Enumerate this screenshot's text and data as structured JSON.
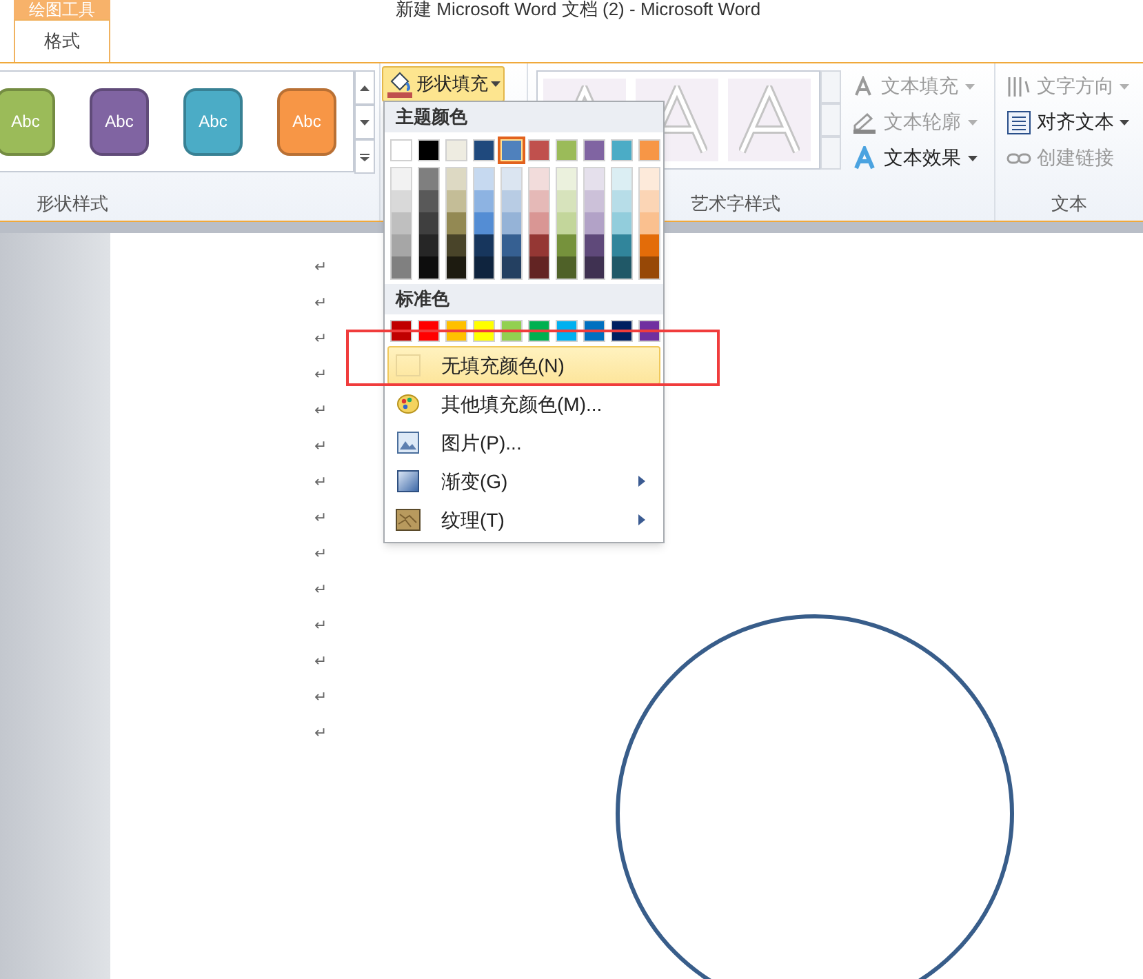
{
  "window": {
    "title": "新建 Microsoft Word 文档 (2) - Microsoft Word"
  },
  "contextual_tab": {
    "label": "绘图工具"
  },
  "tabs": [
    {
      "label": "格式",
      "selected": true
    }
  ],
  "shape_styles": {
    "items": [
      {
        "label": "Abc",
        "color": "#9bbb59"
      },
      {
        "label": "Abc",
        "color": "#8064a2"
      },
      {
        "label": "Abc",
        "color": "#4bacc6"
      },
      {
        "label": "Abc",
        "color": "#f79646"
      }
    ],
    "group_label": "形状样式"
  },
  "shape_fill_button": {
    "label": "形状填充"
  },
  "wordart": {
    "group_label": "艺术字样式",
    "commands": [
      {
        "label": "文本填充",
        "disabled": true
      },
      {
        "label": "文本轮廓",
        "disabled": true
      },
      {
        "label": "文本效果",
        "disabled": false
      }
    ]
  },
  "text_group": {
    "group_label": "文本",
    "commands": [
      {
        "label": "文字方向",
        "disabled": true
      },
      {
        "label": "对齐文本",
        "disabled": false
      },
      {
        "label": "创建链接",
        "disabled": true
      }
    ]
  },
  "fill_menu": {
    "theme_heading": "主题颜色",
    "theme_colors": [
      {
        "color": "#ffffff",
        "selected": false,
        "shades": [
          {
            "color": "#f2f2f2"
          },
          {
            "color": "#d9d9d9"
          },
          {
            "color": "#bfbfbf"
          },
          {
            "color": "#a6a6a6"
          },
          {
            "color": "#808080"
          }
        ]
      },
      {
        "color": "#000000",
        "selected": false,
        "shades": [
          {
            "color": "#7f7f7f"
          },
          {
            "color": "#595959"
          },
          {
            "color": "#3f3f3f"
          },
          {
            "color": "#262626"
          },
          {
            "color": "#0d0d0d"
          }
        ]
      },
      {
        "color": "#eeece1",
        "selected": false,
        "shades": [
          {
            "color": "#ddd9c3"
          },
          {
            "color": "#c4bd97"
          },
          {
            "color": "#938953"
          },
          {
            "color": "#494429"
          },
          {
            "color": "#1d1b10"
          }
        ]
      },
      {
        "color": "#1f497d",
        "selected": false,
        "shades": [
          {
            "color": "#c6d9f0"
          },
          {
            "color": "#8db3e2"
          },
          {
            "color": "#548dd4"
          },
          {
            "color": "#17365d"
          },
          {
            "color": "#0f243e"
          }
        ]
      },
      {
        "color": "#4f81bd",
        "selected": true,
        "shades": [
          {
            "color": "#dbe5f1"
          },
          {
            "color": "#b8cce4"
          },
          {
            "color": "#95b3d7"
          },
          {
            "color": "#366092"
          },
          {
            "color": "#244061"
          }
        ]
      },
      {
        "color": "#c0504d",
        "selected": false,
        "shades": [
          {
            "color": "#f2dcdb"
          },
          {
            "color": "#e5b9b7"
          },
          {
            "color": "#d99694"
          },
          {
            "color": "#953734"
          },
          {
            "color": "#632423"
          }
        ]
      },
      {
        "color": "#9bbb59",
        "selected": false,
        "shades": [
          {
            "color": "#ebf1dd"
          },
          {
            "color": "#d7e3bc"
          },
          {
            "color": "#c3d69b"
          },
          {
            "color": "#76923c"
          },
          {
            "color": "#4f6128"
          }
        ]
      },
      {
        "color": "#8064a2",
        "selected": false,
        "shades": [
          {
            "color": "#e5e0ec"
          },
          {
            "color": "#ccc1d9"
          },
          {
            "color": "#b2a2c7"
          },
          {
            "color": "#5f497a"
          },
          {
            "color": "#3f3151"
          }
        ]
      },
      {
        "color": "#4bacc6",
        "selected": false,
        "shades": [
          {
            "color": "#dbeef3"
          },
          {
            "color": "#b7dde8"
          },
          {
            "color": "#92cddc"
          },
          {
            "color": "#31859b"
          },
          {
            "color": "#205867"
          }
        ]
      },
      {
        "color": "#f79646",
        "selected": false,
        "shades": [
          {
            "color": "#fdeada"
          },
          {
            "color": "#fbd5b5"
          },
          {
            "color": "#fac08f"
          },
          {
            "color": "#e36c09"
          },
          {
            "color": "#974806"
          }
        ]
      }
    ],
    "standard_heading": "标准色",
    "standard_colors": [
      {
        "color": "#c00000"
      },
      {
        "color": "#ff0000"
      },
      {
        "color": "#ffc000"
      },
      {
        "color": "#ffff00"
      },
      {
        "color": "#92d050"
      },
      {
        "color": "#00b050"
      },
      {
        "color": "#00b0f0"
      },
      {
        "color": "#0070c0"
      },
      {
        "color": "#002060"
      },
      {
        "color": "#7030a0"
      }
    ],
    "items": [
      {
        "kind": "none",
        "label": "无填充颜色(N)",
        "highlighted": true,
        "submenu": false
      },
      {
        "kind": "palette",
        "label": "其他填充颜色(M)...",
        "highlighted": false,
        "submenu": false
      },
      {
        "kind": "picture",
        "label": "图片(P)...",
        "highlighted": false,
        "submenu": false
      },
      {
        "kind": "gradient",
        "label": "渐变(G)",
        "highlighted": false,
        "submenu": true
      },
      {
        "kind": "texture",
        "label": "纹理(T)",
        "highlighted": false,
        "submenu": true
      }
    ]
  },
  "document": {
    "paragraph_marks": [
      "↵",
      "↵",
      "↵",
      "↵",
      "↵",
      "↵",
      "↵",
      "↵",
      "↵",
      "↵",
      "↵",
      "↵",
      "↵",
      "↵"
    ]
  }
}
